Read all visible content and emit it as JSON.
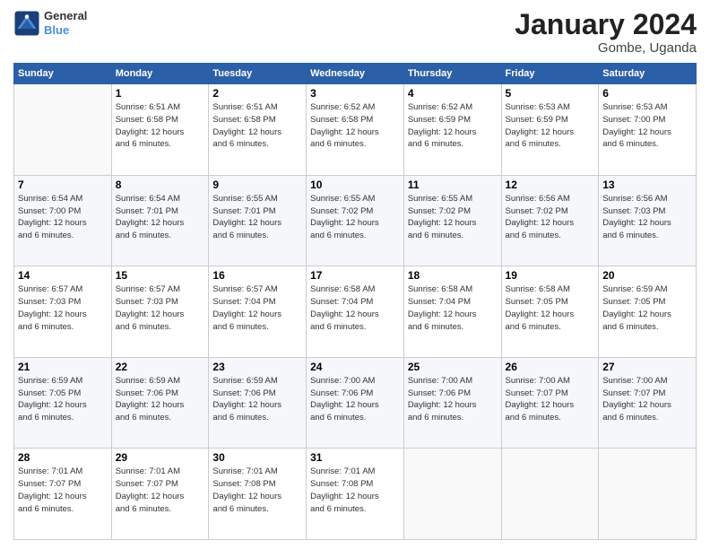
{
  "logo": {
    "line1": "General",
    "line2": "Blue"
  },
  "title": "January 2024",
  "location": "Gombe, Uganda",
  "days_of_week": [
    "Sunday",
    "Monday",
    "Tuesday",
    "Wednesday",
    "Thursday",
    "Friday",
    "Saturday"
  ],
  "weeks": [
    [
      {
        "day": "",
        "info": ""
      },
      {
        "day": "1",
        "info": "Sunrise: 6:51 AM\nSunset: 6:58 PM\nDaylight: 12 hours\nand 6 minutes."
      },
      {
        "day": "2",
        "info": "Sunrise: 6:51 AM\nSunset: 6:58 PM\nDaylight: 12 hours\nand 6 minutes."
      },
      {
        "day": "3",
        "info": "Sunrise: 6:52 AM\nSunset: 6:58 PM\nDaylight: 12 hours\nand 6 minutes."
      },
      {
        "day": "4",
        "info": "Sunrise: 6:52 AM\nSunset: 6:59 PM\nDaylight: 12 hours\nand 6 minutes."
      },
      {
        "day": "5",
        "info": "Sunrise: 6:53 AM\nSunset: 6:59 PM\nDaylight: 12 hours\nand 6 minutes."
      },
      {
        "day": "6",
        "info": "Sunrise: 6:53 AM\nSunset: 7:00 PM\nDaylight: 12 hours\nand 6 minutes."
      }
    ],
    [
      {
        "day": "7",
        "info": "Sunrise: 6:54 AM\nSunset: 7:00 PM\nDaylight: 12 hours\nand 6 minutes."
      },
      {
        "day": "8",
        "info": "Sunrise: 6:54 AM\nSunset: 7:01 PM\nDaylight: 12 hours\nand 6 minutes."
      },
      {
        "day": "9",
        "info": "Sunrise: 6:55 AM\nSunset: 7:01 PM\nDaylight: 12 hours\nand 6 minutes."
      },
      {
        "day": "10",
        "info": "Sunrise: 6:55 AM\nSunset: 7:02 PM\nDaylight: 12 hours\nand 6 minutes."
      },
      {
        "day": "11",
        "info": "Sunrise: 6:55 AM\nSunset: 7:02 PM\nDaylight: 12 hours\nand 6 minutes."
      },
      {
        "day": "12",
        "info": "Sunrise: 6:56 AM\nSunset: 7:02 PM\nDaylight: 12 hours\nand 6 minutes."
      },
      {
        "day": "13",
        "info": "Sunrise: 6:56 AM\nSunset: 7:03 PM\nDaylight: 12 hours\nand 6 minutes."
      }
    ],
    [
      {
        "day": "14",
        "info": "Sunrise: 6:57 AM\nSunset: 7:03 PM\nDaylight: 12 hours\nand 6 minutes."
      },
      {
        "day": "15",
        "info": "Sunrise: 6:57 AM\nSunset: 7:03 PM\nDaylight: 12 hours\nand 6 minutes."
      },
      {
        "day": "16",
        "info": "Sunrise: 6:57 AM\nSunset: 7:04 PM\nDaylight: 12 hours\nand 6 minutes."
      },
      {
        "day": "17",
        "info": "Sunrise: 6:58 AM\nSunset: 7:04 PM\nDaylight: 12 hours\nand 6 minutes."
      },
      {
        "day": "18",
        "info": "Sunrise: 6:58 AM\nSunset: 7:04 PM\nDaylight: 12 hours\nand 6 minutes."
      },
      {
        "day": "19",
        "info": "Sunrise: 6:58 AM\nSunset: 7:05 PM\nDaylight: 12 hours\nand 6 minutes."
      },
      {
        "day": "20",
        "info": "Sunrise: 6:59 AM\nSunset: 7:05 PM\nDaylight: 12 hours\nand 6 minutes."
      }
    ],
    [
      {
        "day": "21",
        "info": "Sunrise: 6:59 AM\nSunset: 7:05 PM\nDaylight: 12 hours\nand 6 minutes."
      },
      {
        "day": "22",
        "info": "Sunrise: 6:59 AM\nSunset: 7:06 PM\nDaylight: 12 hours\nand 6 minutes."
      },
      {
        "day": "23",
        "info": "Sunrise: 6:59 AM\nSunset: 7:06 PM\nDaylight: 12 hours\nand 6 minutes."
      },
      {
        "day": "24",
        "info": "Sunrise: 7:00 AM\nSunset: 7:06 PM\nDaylight: 12 hours\nand 6 minutes."
      },
      {
        "day": "25",
        "info": "Sunrise: 7:00 AM\nSunset: 7:06 PM\nDaylight: 12 hours\nand 6 minutes."
      },
      {
        "day": "26",
        "info": "Sunrise: 7:00 AM\nSunset: 7:07 PM\nDaylight: 12 hours\nand 6 minutes."
      },
      {
        "day": "27",
        "info": "Sunrise: 7:00 AM\nSunset: 7:07 PM\nDaylight: 12 hours\nand 6 minutes."
      }
    ],
    [
      {
        "day": "28",
        "info": "Sunrise: 7:01 AM\nSunset: 7:07 PM\nDaylight: 12 hours\nand 6 minutes."
      },
      {
        "day": "29",
        "info": "Sunrise: 7:01 AM\nSunset: 7:07 PM\nDaylight: 12 hours\nand 6 minutes."
      },
      {
        "day": "30",
        "info": "Sunrise: 7:01 AM\nSunset: 7:08 PM\nDaylight: 12 hours\nand 6 minutes."
      },
      {
        "day": "31",
        "info": "Sunrise: 7:01 AM\nSunset: 7:08 PM\nDaylight: 12 hours\nand 6 minutes."
      },
      {
        "day": "",
        "info": ""
      },
      {
        "day": "",
        "info": ""
      },
      {
        "day": "",
        "info": ""
      }
    ]
  ]
}
